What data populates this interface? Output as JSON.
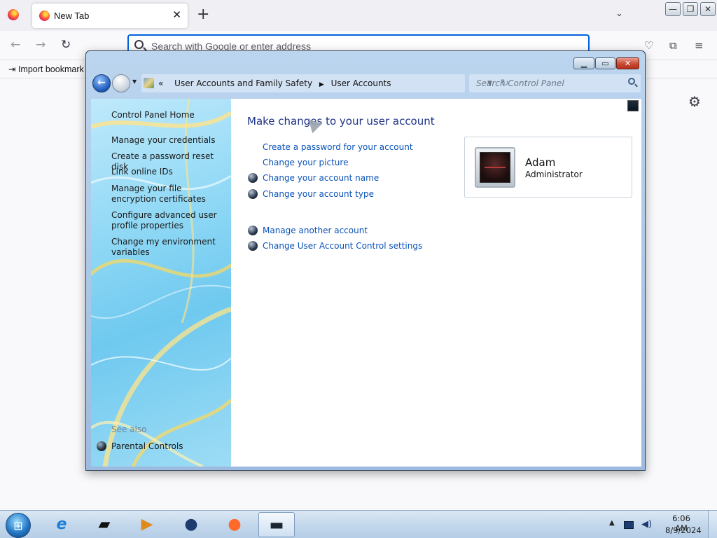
{
  "firefox": {
    "tab_title": "New Tab",
    "url_placeholder": "Search with Google or enter address",
    "import_bookmarks": "Import bookmark",
    "tab_close": "✕",
    "new_tab": "+"
  },
  "control_panel": {
    "breadcrumb": [
      "User Accounts and Family Safety",
      "User Accounts"
    ],
    "search_placeholder": "Search Control Panel",
    "nav": {
      "home": "Control Panel Home",
      "items": [
        "Manage your credentials",
        "Create a password reset disk",
        "Link online IDs",
        "Manage your file encryption certificates",
        "Configure advanced user profile properties",
        "Change my environment variables"
      ],
      "see_also_label": "See also",
      "see_also_items": [
        "Parental Controls"
      ]
    },
    "main": {
      "title": "Make changes to your user account",
      "links": [
        {
          "label": "Create a password for your account",
          "icon": "none"
        },
        {
          "label": "Change your picture",
          "icon": "none"
        },
        {
          "label": "Change your account name",
          "icon": "uac-shield-icon"
        },
        {
          "label": "Change your account type",
          "icon": "uac-shield-icon"
        },
        {
          "label": "Manage another account",
          "icon": "uac-shield-icon"
        },
        {
          "label": "Change User Account Control settings",
          "icon": "uac-shield-icon"
        }
      ]
    },
    "user": {
      "name": "Adam",
      "role": "Administrator"
    }
  },
  "taskbar": {
    "apps": [
      "internet-explorer",
      "terminal",
      "media-player",
      "network",
      "firefox",
      "control-panel-window"
    ],
    "time": "6:06 AM",
    "date": "8/9/2024"
  },
  "colors": {
    "link": "#0a52b8",
    "heading": "#1e3287",
    "firefox_accent": "#0061e0"
  }
}
